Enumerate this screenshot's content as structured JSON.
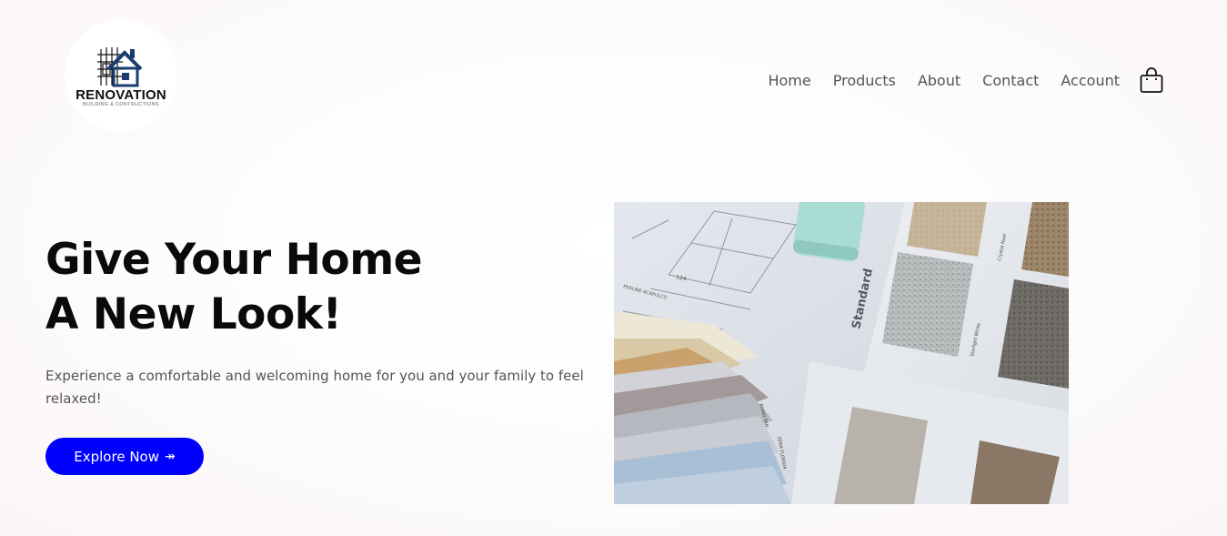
{
  "brand": {
    "name": "RENOVATION",
    "tagline": "BUILDING & CONTRUCTIONS",
    "logo_icon": "house-blueprint-icon",
    "accent_color": "#1b3d6d"
  },
  "nav": {
    "items": [
      {
        "label": "Home"
      },
      {
        "label": "Products"
      },
      {
        "label": "About"
      },
      {
        "label": "Contact"
      },
      {
        "label": "Account"
      }
    ],
    "cart_icon": "shopping-bag-icon"
  },
  "hero": {
    "title_line1": "Give Your Home",
    "title_line2": "A New Look!",
    "description": "Experience a comfortable and welcoming home for you and your family to feel relaxed!",
    "cta_label": "Explore Now",
    "cta_icon": "arrow-right-icon",
    "cta_color": "#0000ff",
    "image_labels": {
      "card_label": "Standard",
      "sample_1": "Starlight White",
      "sample_2": "Crystal Noel",
      "plan_dimension": "124",
      "swatch_1": "PERLINE ACAPULCO",
      "swatch_2": "KHAKI TAN",
      "swatch_3": "ZERA FLORIDA"
    }
  }
}
